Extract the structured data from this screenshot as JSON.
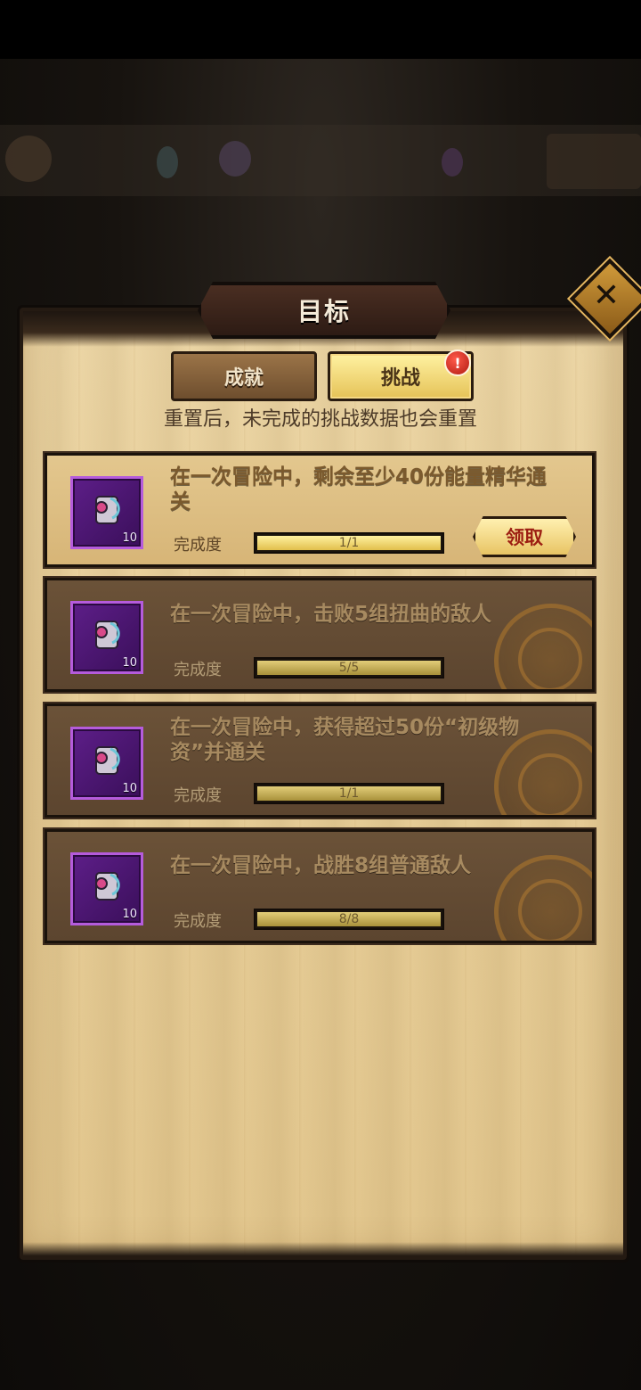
{
  "window": {
    "title": "目标",
    "close_icon": "✕"
  },
  "tabs": [
    {
      "label": "成就",
      "active": false
    },
    {
      "label": "挑战",
      "active": true,
      "badge": "!"
    }
  ],
  "subtitle": "重置后，未完成的挑战数据也会重置",
  "challenges": [
    {
      "title": "在一次冒险中，剩余至少40份能量精华通关",
      "progress_label": "完成度",
      "progress_text": "1/1",
      "progress_fraction": 1.0,
      "reward_count": "10",
      "claim_label": "领取"
    },
    {
      "title": "在一次冒险中，击败5组扭曲的敌人",
      "progress_label": "完成度",
      "progress_text": "5/5",
      "progress_fraction": 1.0,
      "reward_count": "10"
    },
    {
      "title": "在一次冒险中，获得超过50份“初级物资”并通关",
      "progress_label": "完成度",
      "progress_text": "1/1",
      "progress_fraction": 1.0,
      "reward_count": "10"
    },
    {
      "title": "在一次冒险中，战胜8组普通敌人",
      "progress_label": "完成度",
      "progress_text": "8/8",
      "progress_fraction": 1.0,
      "reward_count": "10"
    }
  ],
  "colors": {
    "panel": "#e6cd98",
    "card_claimed": "#5c452f",
    "card_claimable": "#d7b577",
    "reward_frame": "#b55bdc",
    "claim_text": "#9c1e12"
  },
  "icons": [
    "close-icon",
    "scroll-reward-icon",
    "alert-icon"
  ]
}
